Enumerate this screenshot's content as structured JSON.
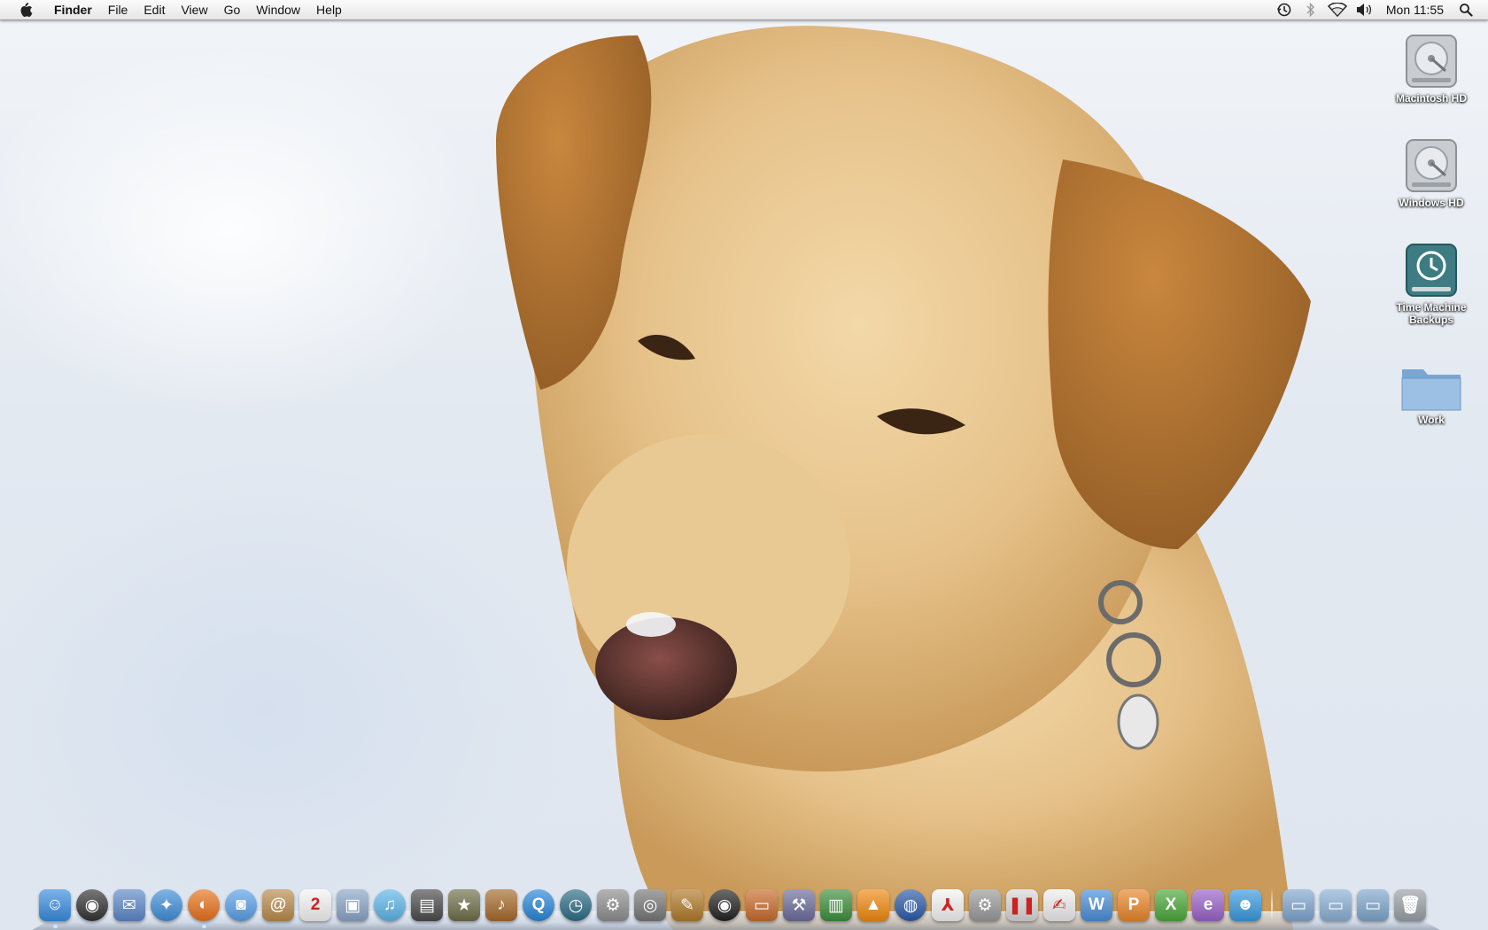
{
  "menubar": {
    "apple_icon": "apple-logo",
    "app_name": "Finder",
    "menus": [
      "File",
      "Edit",
      "View",
      "Go",
      "Window",
      "Help"
    ],
    "status_icons": [
      "time-machine-icon",
      "bluetooth-icon",
      "wifi-icon",
      "volume-icon"
    ],
    "clock": "Mon 11:55",
    "spotlight_icon": "spotlight-search-icon"
  },
  "desktop": {
    "icons": [
      {
        "label": "Macintosh HD",
        "icon": "hard-drive-icon"
      },
      {
        "label": "Windows HD",
        "icon": "hard-drive-icon"
      },
      {
        "label": "Time Machine Backups",
        "icon": "time-machine-drive-icon"
      },
      {
        "label": "Work",
        "icon": "folder-icon"
      }
    ]
  },
  "dock": {
    "apps": [
      {
        "icon": "finder-icon",
        "glyph": "☺",
        "color": "#3b8de0",
        "running": true
      },
      {
        "icon": "dashboard-icon",
        "glyph": "◉",
        "color": "#333333",
        "round": true
      },
      {
        "icon": "mail-icon",
        "glyph": "✉",
        "color": "#5d88c8"
      },
      {
        "icon": "safari-icon",
        "glyph": "✦",
        "color": "#3f8fd8",
        "round": true
      },
      {
        "icon": "firefox-icon",
        "glyph": "◐",
        "color": "#e8721c",
        "round": true,
        "running": true
      },
      {
        "icon": "ichat-icon",
        "glyph": "◙",
        "color": "#5aa0e8",
        "round": true
      },
      {
        "icon": "address-book-icon",
        "glyph": "@",
        "color": "#b98b4c"
      },
      {
        "icon": "ical-icon",
        "glyph": "2",
        "color": "#f4f4f4"
      },
      {
        "icon": "iphoto-icon",
        "glyph": "▣",
        "color": "#8aa5c7"
      },
      {
        "icon": "itunes-icon",
        "glyph": "♫",
        "color": "#5db6e8",
        "round": true
      },
      {
        "icon": "photo-booth-icon",
        "glyph": "▤",
        "color": "#4b4b4b"
      },
      {
        "icon": "imovie-icon",
        "glyph": "★",
        "color": "#6f6f4a"
      },
      {
        "icon": "garageband-icon",
        "glyph": "♪",
        "color": "#a66a2c"
      },
      {
        "icon": "quicktime-icon",
        "glyph": "Q",
        "color": "#2a86d8",
        "round": true
      },
      {
        "icon": "time-machine-icon",
        "glyph": "◷",
        "color": "#2e6c86",
        "round": true
      },
      {
        "icon": "system-preferences-icon",
        "glyph": "⚙",
        "color": "#8e8e8e"
      },
      {
        "icon": "disk-utility-icon",
        "glyph": "◎",
        "color": "#777777"
      },
      {
        "icon": "script-editor-icon",
        "glyph": "✎",
        "color": "#b07a2a"
      },
      {
        "icon": "aperture-icon",
        "glyph": "◉",
        "color": "#222222",
        "round": true
      },
      {
        "icon": "keynote-icon",
        "glyph": "▭",
        "color": "#c86b2c"
      },
      {
        "icon": "xcode-icon",
        "glyph": "⚒",
        "color": "#6c6c9c"
      },
      {
        "icon": "numbers-icon",
        "glyph": "▥",
        "color": "#3d8f3d"
      },
      {
        "icon": "vlc-icon",
        "glyph": "▲",
        "color": "#f08a12"
      },
      {
        "icon": "google-earth-icon",
        "glyph": "◍",
        "color": "#2b5aa8",
        "round": true
      },
      {
        "icon": "adobe-reader-icon",
        "glyph": "⅄",
        "color": "#f4f4f4"
      },
      {
        "icon": "automator-icon",
        "glyph": "⚙",
        "color": "#9a9a9a"
      },
      {
        "icon": "parallels-icon",
        "glyph": "❚❚",
        "color": "#d8d8d8"
      },
      {
        "icon": "textedit-icon",
        "glyph": "✍",
        "color": "#eeeeee"
      },
      {
        "icon": "word-icon",
        "glyph": "W",
        "color": "#4a8ed8"
      },
      {
        "icon": "powerpoint-icon",
        "glyph": "P",
        "color": "#e8862a"
      },
      {
        "icon": "excel-icon",
        "glyph": "X",
        "color": "#4aa83a"
      },
      {
        "icon": "entourage-icon",
        "glyph": "e",
        "color": "#9a62c8"
      },
      {
        "icon": "messenger-icon",
        "glyph": "☻",
        "color": "#3a9adf"
      }
    ],
    "stacks": [
      {
        "icon": "applications-stack-icon",
        "color": "#7fa7cf"
      },
      {
        "icon": "documents-stack-icon",
        "color": "#8ab0d4"
      },
      {
        "icon": "downloads-stack-icon",
        "color": "#7ea6cc"
      },
      {
        "icon": "trash-icon",
        "color": "#9aa0a6"
      }
    ]
  }
}
